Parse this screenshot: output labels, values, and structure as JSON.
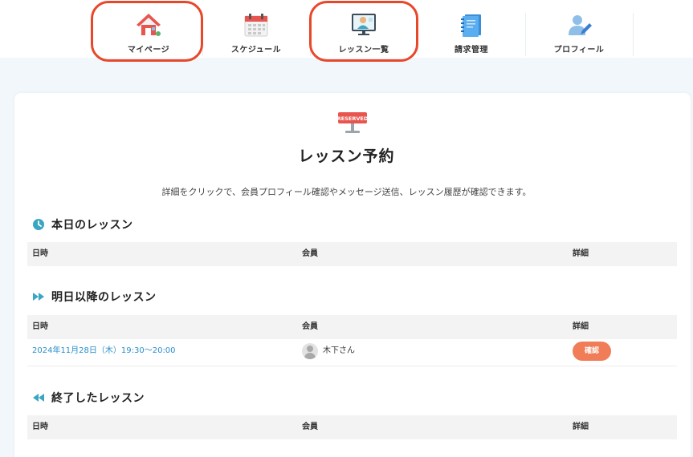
{
  "nav": {
    "items": [
      {
        "label": "マイページ",
        "icon": "house-icon"
      },
      {
        "label": "スケジュール",
        "icon": "calendar-icon"
      },
      {
        "label": "レッスン一覧",
        "icon": "teacher-screen-icon"
      },
      {
        "label": "請求管理",
        "icon": "notebook-icon"
      },
      {
        "label": "プロフィール",
        "icon": "profile-edit-icon"
      }
    ]
  },
  "page": {
    "icon": "reserved-sign-icon",
    "icon_text": "RESERVED",
    "title": "レッスン予約",
    "description": "詳細をクリックで、会員プロフィール確認やメッセージ送信、レッスン履歴が確認できます。"
  },
  "table_headers": {
    "date": "日時",
    "member": "会員",
    "detail": "詳細"
  },
  "sections": {
    "today": {
      "title": "本日のレッスン",
      "icon": "clock-icon",
      "rows": []
    },
    "upcoming": {
      "title": "明日以降のレッスン",
      "icon": "fast-forward-icon",
      "rows": [
        {
          "date": "2024年11月28日（木）19:30〜20:00",
          "member": "木下さん",
          "action": "確認"
        }
      ]
    },
    "finished": {
      "title": "終了したレッスン",
      "icon": "rewind-icon",
      "rows": []
    }
  },
  "colors": {
    "accent": "#3aa6c4",
    "link": "#2a8ec9",
    "button": "#f07d57",
    "annotation": "#e8472a"
  }
}
